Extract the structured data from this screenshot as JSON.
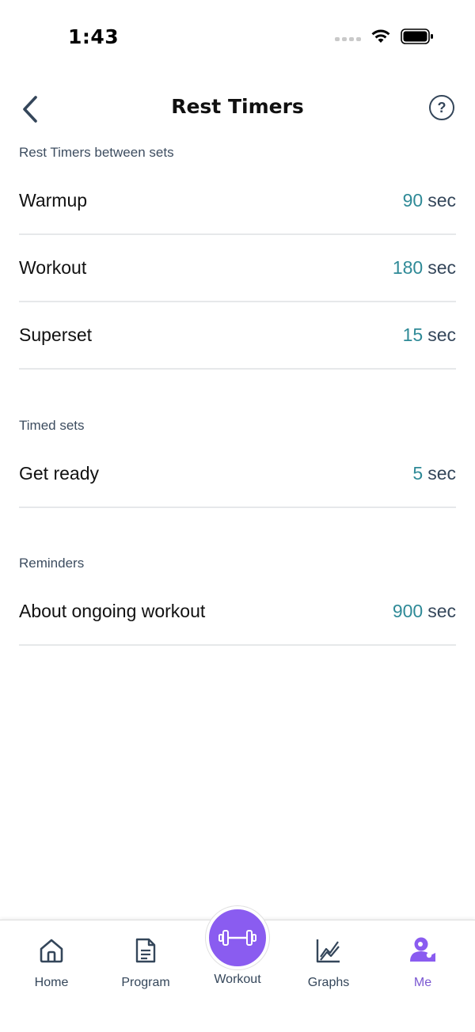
{
  "status_bar": {
    "time": "1:43"
  },
  "header": {
    "title": "Rest Timers",
    "help_symbol": "?"
  },
  "sections": [
    {
      "label": "Rest Timers between sets",
      "rows": [
        {
          "label": "Warmup",
          "value": "90",
          "unit": "sec"
        },
        {
          "label": "Workout",
          "value": "180",
          "unit": "sec"
        },
        {
          "label": "Superset",
          "value": "15",
          "unit": "sec"
        }
      ]
    },
    {
      "label": "Timed sets",
      "rows": [
        {
          "label": "Get ready",
          "value": "5",
          "unit": "sec"
        }
      ]
    },
    {
      "label": "Reminders",
      "rows": [
        {
          "label": "About ongoing workout",
          "value": "900",
          "unit": "sec"
        }
      ]
    }
  ],
  "tab_bar": {
    "home": {
      "label": "Home",
      "icon": "home-icon"
    },
    "program": {
      "label": "Program",
      "icon": "document-icon"
    },
    "workout": {
      "label": "Workout",
      "icon": "dumbbell-icon"
    },
    "graphs": {
      "label": "Graphs",
      "icon": "graph-icon"
    },
    "me": {
      "label": "Me",
      "icon": "user-icon"
    },
    "active": "me"
  },
  "colors": {
    "accent": "#8a5cf0",
    "value": "#2f8a97",
    "text_secondary": "#34465a"
  }
}
